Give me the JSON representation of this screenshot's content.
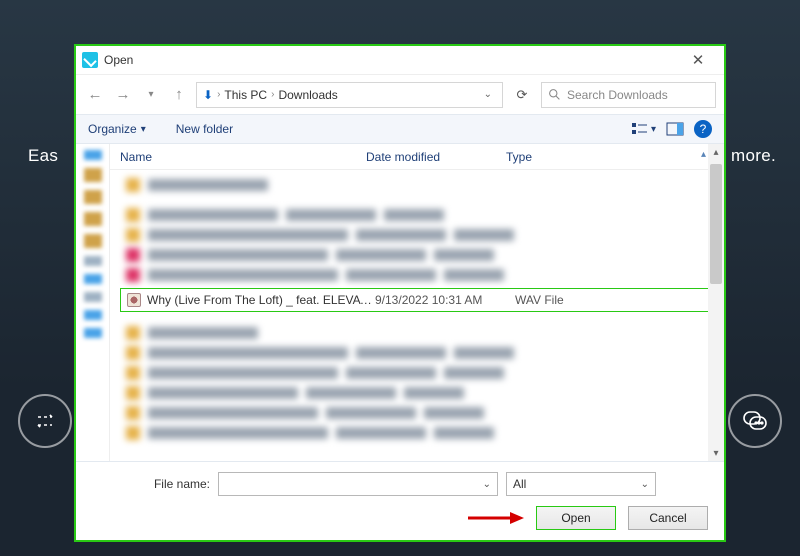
{
  "background": {
    "text_left": "Eas",
    "text_right": "more."
  },
  "titlebar": {
    "title": "Open"
  },
  "nav": {
    "crumbs": {
      "root": "This PC",
      "folder": "Downloads"
    },
    "search_placeholder": "Search Downloads"
  },
  "toolbar": {
    "organize": "Organize",
    "new_folder": "New folder"
  },
  "columns": {
    "name": "Name",
    "date": "Date modified",
    "type": "Type"
  },
  "selected": {
    "name": "Why (Live From The Loft) _ feat. ELEVATI…",
    "date": "9/13/2022 10:31 AM",
    "type": "WAV File"
  },
  "footer": {
    "filename_label": "File name:",
    "filename_value": "",
    "filter_value": "All",
    "open": "Open",
    "cancel": "Cancel"
  }
}
